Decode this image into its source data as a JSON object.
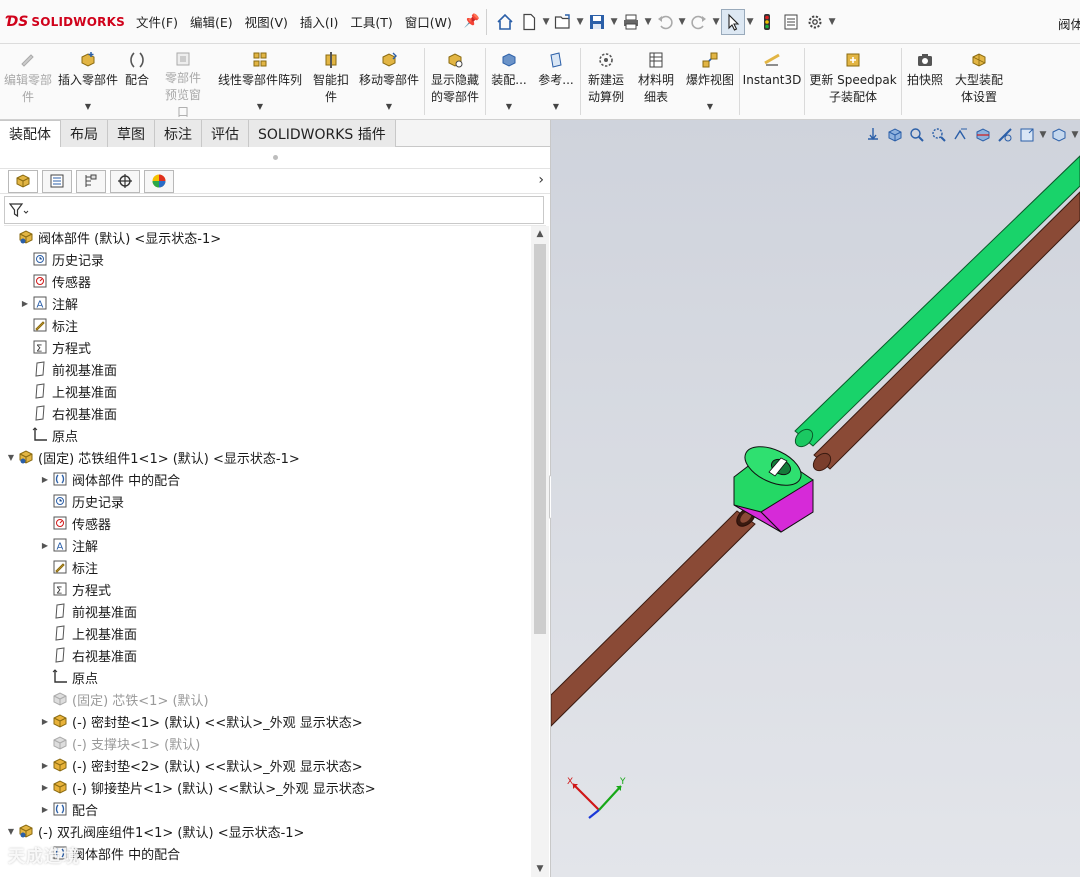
{
  "app": {
    "brand": "SOLIDWORKS",
    "doc_title_fragment": "阀体"
  },
  "menu": [
    "文件(F)",
    "编辑(E)",
    "视图(V)",
    "插入(I)",
    "工具(T)",
    "窗口(W)"
  ],
  "commands": [
    {
      "label": "编辑零部件",
      "icon": "edit-component-icon",
      "enabled": false,
      "dropdown": false
    },
    {
      "label": "插入零部件",
      "icon": "insert-component-icon",
      "enabled": true,
      "dropdown": true
    },
    {
      "label": "配合",
      "icon": "mate-icon",
      "enabled": true,
      "dropdown": false
    },
    {
      "label": "零部件预览窗口",
      "icon": "component-preview-icon",
      "enabled": false,
      "dropdown": false
    },
    {
      "label": "线性零部件阵列",
      "icon": "linear-pattern-icon",
      "enabled": true,
      "dropdown": true
    },
    {
      "label": "智能扣件",
      "icon": "smart-fasteners-icon",
      "enabled": true,
      "dropdown": false
    },
    {
      "label": "移动零部件",
      "icon": "move-component-icon",
      "enabled": true,
      "dropdown": true
    },
    {
      "label": "显示隐藏的零部件",
      "icon": "show-hidden-icon",
      "enabled": true,
      "dropdown": false
    },
    {
      "label": "装配...",
      "icon": "assembly-features-icon",
      "enabled": true,
      "dropdown": true
    },
    {
      "label": "参考...",
      "icon": "reference-geometry-icon",
      "enabled": true,
      "dropdown": true
    },
    {
      "label": "新建运动算例",
      "icon": "motion-study-icon",
      "enabled": true,
      "dropdown": false
    },
    {
      "label": "材料明细表",
      "icon": "bom-icon",
      "enabled": true,
      "dropdown": false
    },
    {
      "label": "爆炸视图",
      "icon": "exploded-view-icon",
      "enabled": true,
      "dropdown": true
    },
    {
      "label": "Instant3D",
      "icon": "instant3d-icon",
      "enabled": true,
      "dropdown": false
    },
    {
      "label": "更新 Speedpak 子装配体",
      "icon": "speedpak-icon",
      "enabled": true,
      "dropdown": false
    },
    {
      "label": "拍快照",
      "icon": "snapshot-icon",
      "enabled": true,
      "dropdown": false
    },
    {
      "label": "大型装配体设置",
      "icon": "large-assembly-icon",
      "enabled": true,
      "dropdown": false
    }
  ],
  "tabs": [
    "装配体",
    "布局",
    "草图",
    "标注",
    "评估",
    "SOLIDWORKS 插件"
  ],
  "active_tab": "装配体",
  "tree": [
    {
      "label": "阀体部件 (默认) <显示状态-1>",
      "icon": "assembly-icon",
      "level": 0,
      "exp": "none",
      "dim": false
    },
    {
      "label": "历史记录",
      "icon": "history-icon",
      "level": 1,
      "exp": "none",
      "dim": false
    },
    {
      "label": "传感器",
      "icon": "sensor-icon",
      "level": 1,
      "exp": "none",
      "dim": false
    },
    {
      "label": "注解",
      "icon": "annotation-icon",
      "level": 1,
      "exp": "collapsed",
      "dim": false
    },
    {
      "label": "标注",
      "icon": "markup-icon",
      "level": 1,
      "exp": "none",
      "dim": false
    },
    {
      "label": "方程式",
      "icon": "equation-icon",
      "level": 1,
      "exp": "none",
      "dim": false
    },
    {
      "label": "前视基准面",
      "icon": "plane-icon",
      "level": 1,
      "exp": "none",
      "dim": false
    },
    {
      "label": "上视基准面",
      "icon": "plane-icon",
      "level": 1,
      "exp": "none",
      "dim": false
    },
    {
      "label": "右视基准面",
      "icon": "plane-icon",
      "level": 1,
      "exp": "none",
      "dim": false
    },
    {
      "label": "原点",
      "icon": "origin-icon",
      "level": 1,
      "exp": "none",
      "dim": false
    },
    {
      "label": "(固定) 芯铁组件1<1> (默认) <显示状态-1>",
      "icon": "assembly-icon",
      "level": 0,
      "exp": "expanded",
      "dim": false
    },
    {
      "label": "阀体部件 中的配合",
      "icon": "mates-icon",
      "level": 2,
      "exp": "collapsed",
      "dim": false
    },
    {
      "label": "历史记录",
      "icon": "history-icon",
      "level": 2,
      "exp": "none",
      "dim": false
    },
    {
      "label": "传感器",
      "icon": "sensor-icon",
      "level": 2,
      "exp": "none",
      "dim": false
    },
    {
      "label": "注解",
      "icon": "annotation-icon",
      "level": 2,
      "exp": "collapsed",
      "dim": false
    },
    {
      "label": "标注",
      "icon": "markup-icon",
      "level": 2,
      "exp": "none",
      "dim": false
    },
    {
      "label": "方程式",
      "icon": "equation-icon",
      "level": 2,
      "exp": "none",
      "dim": false
    },
    {
      "label": "前视基准面",
      "icon": "plane-icon",
      "level": 2,
      "exp": "none",
      "dim": false
    },
    {
      "label": "上视基准面",
      "icon": "plane-icon",
      "level": 2,
      "exp": "none",
      "dim": false
    },
    {
      "label": "右视基准面",
      "icon": "plane-icon",
      "level": 2,
      "exp": "none",
      "dim": false
    },
    {
      "label": "原点",
      "icon": "origin-icon",
      "level": 2,
      "exp": "none",
      "dim": false
    },
    {
      "label": "(固定) 芯铁<1> (默认)",
      "icon": "part-hidden-icon",
      "level": 2,
      "exp": "none",
      "dim": true
    },
    {
      "label": "(-) 密封垫<1> (默认) <<默认>_外观 显示状态>",
      "icon": "part-icon",
      "level": 2,
      "exp": "collapsed",
      "dim": false
    },
    {
      "label": "(-) 支撑块<1> (默认)",
      "icon": "part-hidden-icon",
      "level": 2,
      "exp": "none",
      "dim": true
    },
    {
      "label": "(-) 密封垫<2> (默认) <<默认>_外观 显示状态>",
      "icon": "part-icon",
      "level": 2,
      "exp": "collapsed",
      "dim": false
    },
    {
      "label": "(-) 铆接垫片<1> (默认) <<默认>_外观 显示状态>",
      "icon": "part-icon",
      "level": 2,
      "exp": "collapsed",
      "dim": false
    },
    {
      "label": "配合",
      "icon": "mates-icon",
      "level": 2,
      "exp": "collapsed",
      "dim": false
    },
    {
      "label": "(-) 双孔阀座组件1<1> (默认) <显示状态-1>",
      "icon": "assembly-icon",
      "level": 0,
      "exp": "expanded",
      "dim": false
    },
    {
      "label": "阀体部件 中的配合",
      "icon": "mates-icon",
      "level": 2,
      "exp": "none",
      "dim": false
    }
  ],
  "watermark": "天成造境",
  "colors": {
    "green_rod": "#19d36a",
    "brown_rod": "#8a4a36",
    "valve_green": "#24d865",
    "valve_magenta": "#d62ad8",
    "viewport_bg": "#d3d6de"
  },
  "triad": {
    "x_label": "X",
    "y_label": "Y"
  }
}
